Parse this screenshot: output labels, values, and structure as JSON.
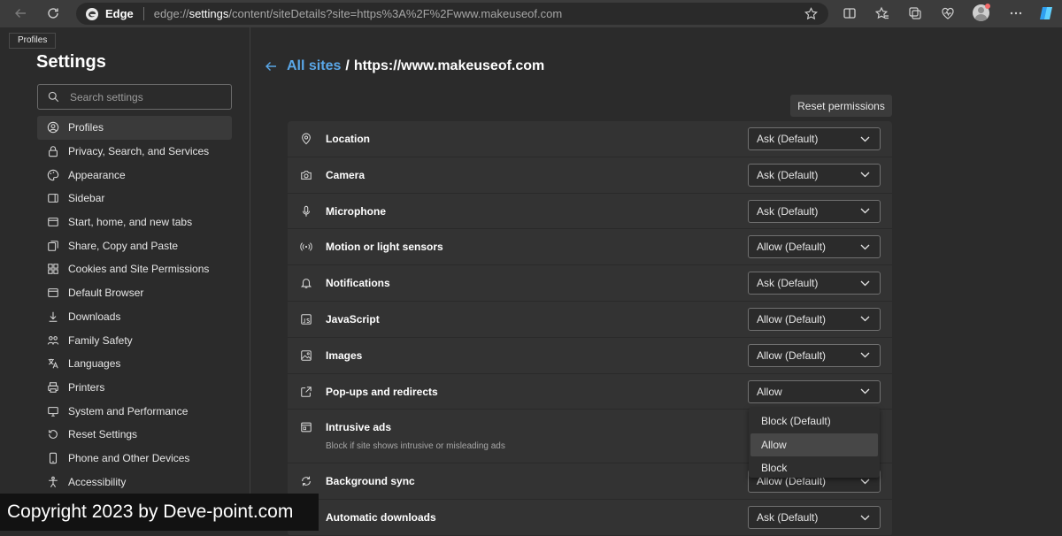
{
  "browser": {
    "name": "Edge",
    "url_prefix": "edge://",
    "url_host": "settings",
    "url_rest": "/content/siteDetails?site=https%3A%2F%2Fwww.makeuseof.com",
    "tooltip": "Profiles"
  },
  "sidebar": {
    "title": "Settings",
    "search_placeholder": "Search settings",
    "items": [
      {
        "label": "Profiles",
        "icon": "profile-icon",
        "active": true
      },
      {
        "label": "Privacy, Search, and Services",
        "icon": "lock-icon"
      },
      {
        "label": "Appearance",
        "icon": "palette-icon"
      },
      {
        "label": "Sidebar",
        "icon": "sidebar-icon"
      },
      {
        "label": "Start, home, and new tabs",
        "icon": "home-icon"
      },
      {
        "label": "Share, Copy and Paste",
        "icon": "share-icon"
      },
      {
        "label": "Cookies and Site Permissions",
        "icon": "cookie-icon"
      },
      {
        "label": "Default Browser",
        "icon": "browser-icon"
      },
      {
        "label": "Downloads",
        "icon": "download-icon"
      },
      {
        "label": "Family Safety",
        "icon": "family-icon"
      },
      {
        "label": "Languages",
        "icon": "language-icon"
      },
      {
        "label": "Printers",
        "icon": "printer-icon"
      },
      {
        "label": "System and Performance",
        "icon": "system-icon"
      },
      {
        "label": "Reset Settings",
        "icon": "reset-icon"
      },
      {
        "label": "Phone and Other Devices",
        "icon": "phone-icon"
      },
      {
        "label": "Accessibility",
        "icon": "accessibility-icon"
      }
    ]
  },
  "main": {
    "breadcrumb_link": "All sites",
    "breadcrumb_separator": "/",
    "breadcrumb_site": "https://www.makeuseof.com",
    "reset_label": "Reset permissions",
    "permissions": [
      {
        "label": "Location",
        "value": "Ask (Default)",
        "icon": "location-icon"
      },
      {
        "label": "Camera",
        "value": "Ask (Default)",
        "icon": "camera-icon"
      },
      {
        "label": "Microphone",
        "value": "Ask (Default)",
        "icon": "microphone-icon"
      },
      {
        "label": "Motion or light sensors",
        "value": "Allow (Default)",
        "icon": "sensor-icon"
      },
      {
        "label": "Notifications",
        "value": "Ask (Default)",
        "icon": "bell-icon"
      },
      {
        "label": "JavaScript",
        "value": "Allow (Default)",
        "icon": "javascript-icon"
      },
      {
        "label": "Images",
        "value": "Allow (Default)",
        "icon": "image-icon"
      },
      {
        "label": "Pop-ups and redirects",
        "value": "Allow",
        "icon": "popup-icon"
      },
      {
        "label": "Intrusive ads",
        "description": "Block if site shows intrusive or misleading ads",
        "icon": "ads-icon"
      },
      {
        "label": "Background sync",
        "value": "Allow (Default)",
        "icon": "sync-icon"
      },
      {
        "label": "Automatic downloads",
        "value": "Ask (Default)",
        "icon": "download-icon"
      }
    ],
    "dropdown_options": [
      "Block (Default)",
      "Allow",
      "Block"
    ],
    "dropdown_selected": "Allow"
  },
  "watermark": "Copyright 2023 by Deve-point.com",
  "colors": {
    "accent": "#5aa7e8",
    "background": "#2b2b2b",
    "panel": "#333333"
  }
}
